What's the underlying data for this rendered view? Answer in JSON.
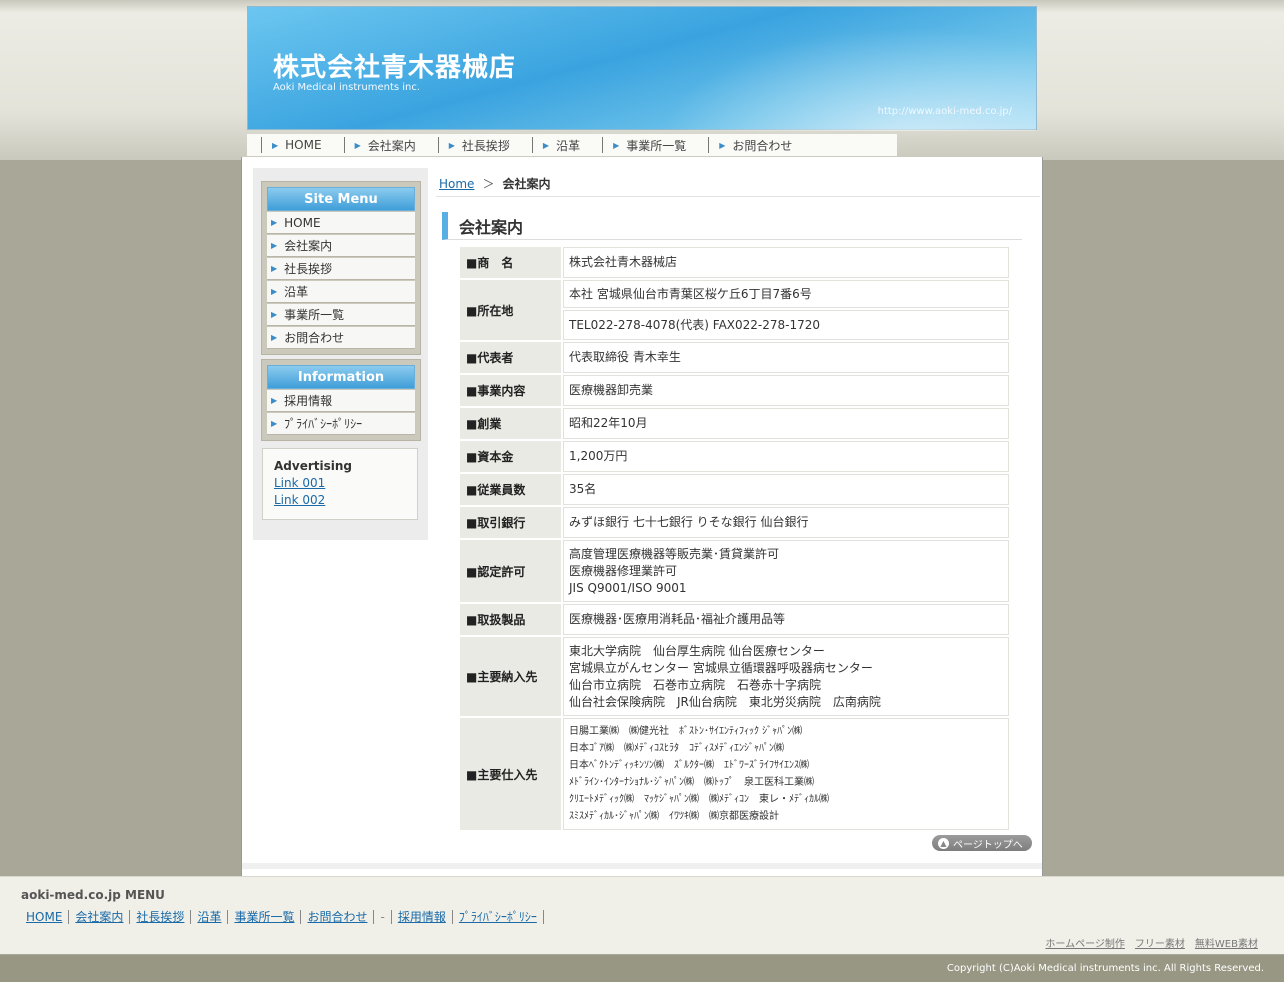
{
  "header": {
    "title": "株式会社青木器械店",
    "subtitle": "Aoki Medical instruments inc.",
    "url": "http://www.aoki-med.co.jp/"
  },
  "global_nav": [
    "HOME",
    "会社案内",
    "社長挨拶",
    "沿革",
    "事業所一覧",
    "お問合わせ"
  ],
  "sidebar": {
    "site_menu_title": "Site Menu",
    "site_menu_items": [
      "HOME",
      "会社案内",
      "社長挨拶",
      "沿革",
      "事業所一覧",
      "お問合わせ"
    ],
    "info_title": "Information",
    "info_items": [
      "採用情報",
      "ﾌﾟﾗｲﾊﾞｼｰﾎﾟﾘｼｰ"
    ],
    "ad_title": "Advertising",
    "ad_links": [
      "Link 001",
      "Link 002"
    ]
  },
  "breadcrumb": {
    "home": "Home",
    "separator": "＞",
    "current": "会社案内"
  },
  "page_heading": "会社案内",
  "company_table": {
    "name_label": "■商　名",
    "name_value": "株式会社青木器械店",
    "address_label": "■所在地",
    "address_value": "本社 宮城県仙台市青葉区桜ケ丘6丁目7番6号",
    "phone_value": "TEL022-278-4078(代表) FAX022-278-1720",
    "rep_label": "■代表者",
    "rep_value": "代表取締役 青木幸生",
    "business_label": "■事業内容",
    "business_value": "医療機器卸売業",
    "founded_label": "■創業",
    "founded_value": "昭和22年10月",
    "capital_label": "■資本金",
    "capital_value": "1,200万円",
    "employees_label": "■従業員数",
    "employees_value": "35名",
    "banks_label": "■取引銀行",
    "banks_value": "みずほ銀行 七十七銀行 りそな銀行 仙台銀行",
    "license_label": "■認定許可",
    "license_lines": [
      "高度管理医療機器等販売業･賃貸業許可",
      "医療機器修理業許可",
      "JIS Q9001/ISO 9001"
    ],
    "products_label": "■取扱製品",
    "products_value": "医療機器･医療用消耗品･福祉介護用品等",
    "customers_label": "■主要納入先",
    "customers_lines": [
      "東北大学病院　仙台厚生病院 仙台医療センター",
      "宮城県立がんセンター 宮城県立循環器呼吸器病センター",
      "仙台市立病院　石巻市立病院　石巻赤十字病院",
      "仙台社会保険病院　JR仙台病院　東北労災病院　広南病院"
    ],
    "suppliers_label": "■主要仕入先",
    "suppliers_lines": [
      "日腸工業㈱　㈱健光社　ﾎﾞｽﾄﾝ･ｻｲｴﾝﾃｨﾌｨｯｸ ｼﾞｬﾊﾟﾝ㈱",
      "日本ｺﾞｱ㈱　㈱ﾒﾃﾞｨｺｽﾋﾗﾀ　ｺﾃﾞｨｽﾒﾃﾞｨｴﾝｼﾞｬﾊﾟﾝ㈱",
      "日本ﾍﾞｸﾄﾝﾃﾞｨｯｷﾝｿﾝ㈱　ｽﾞﾙｸﾀｰ㈱　ｴﾄﾞﾜｰｽﾞﾗｲﾌｻｲｴﾝｽ㈱",
      "ﾒﾄﾞﾗｲﾝ･ｲﾝﾀｰﾅｼｮﾅﾙ･ｼﾞｬﾊﾟﾝ㈱　㈱ﾄｯﾌﾟ　泉工医科工業㈱",
      "ｸﾘｴｰﾄﾒﾃﾞｨｯｸ㈱　ﾏｯｹｼﾞｬﾊﾟﾝ㈱　㈱ﾒﾃﾞｨｺﾝ　東レ・ﾒﾃﾞｨｶﾙ㈱",
      "ｽﾐｽﾒﾃﾞｨｶﾙ･ｼﾞｬﾊﾟﾝ㈱　ｲﾜﾂｷ㈱　㈱京都医療設計"
    ]
  },
  "pagetop_label": "ページトップへ",
  "footer": {
    "menu_title": "aoki-med.co.jp MENU",
    "links": [
      "HOME",
      "会社案内",
      "社長挨拶",
      "沿革",
      "事業所一覧",
      "お問合わせ",
      "-",
      "採用情報",
      "ﾌﾟﾗｲﾊﾞｼｰﾎﾟﾘｼｰ"
    ],
    "right_links": [
      "ホームページ制作",
      "フリー素材",
      "無料WEB素材"
    ],
    "copyright": "Copyright (C)Aoki Medical instruments inc. All Rights Reserved."
  }
}
